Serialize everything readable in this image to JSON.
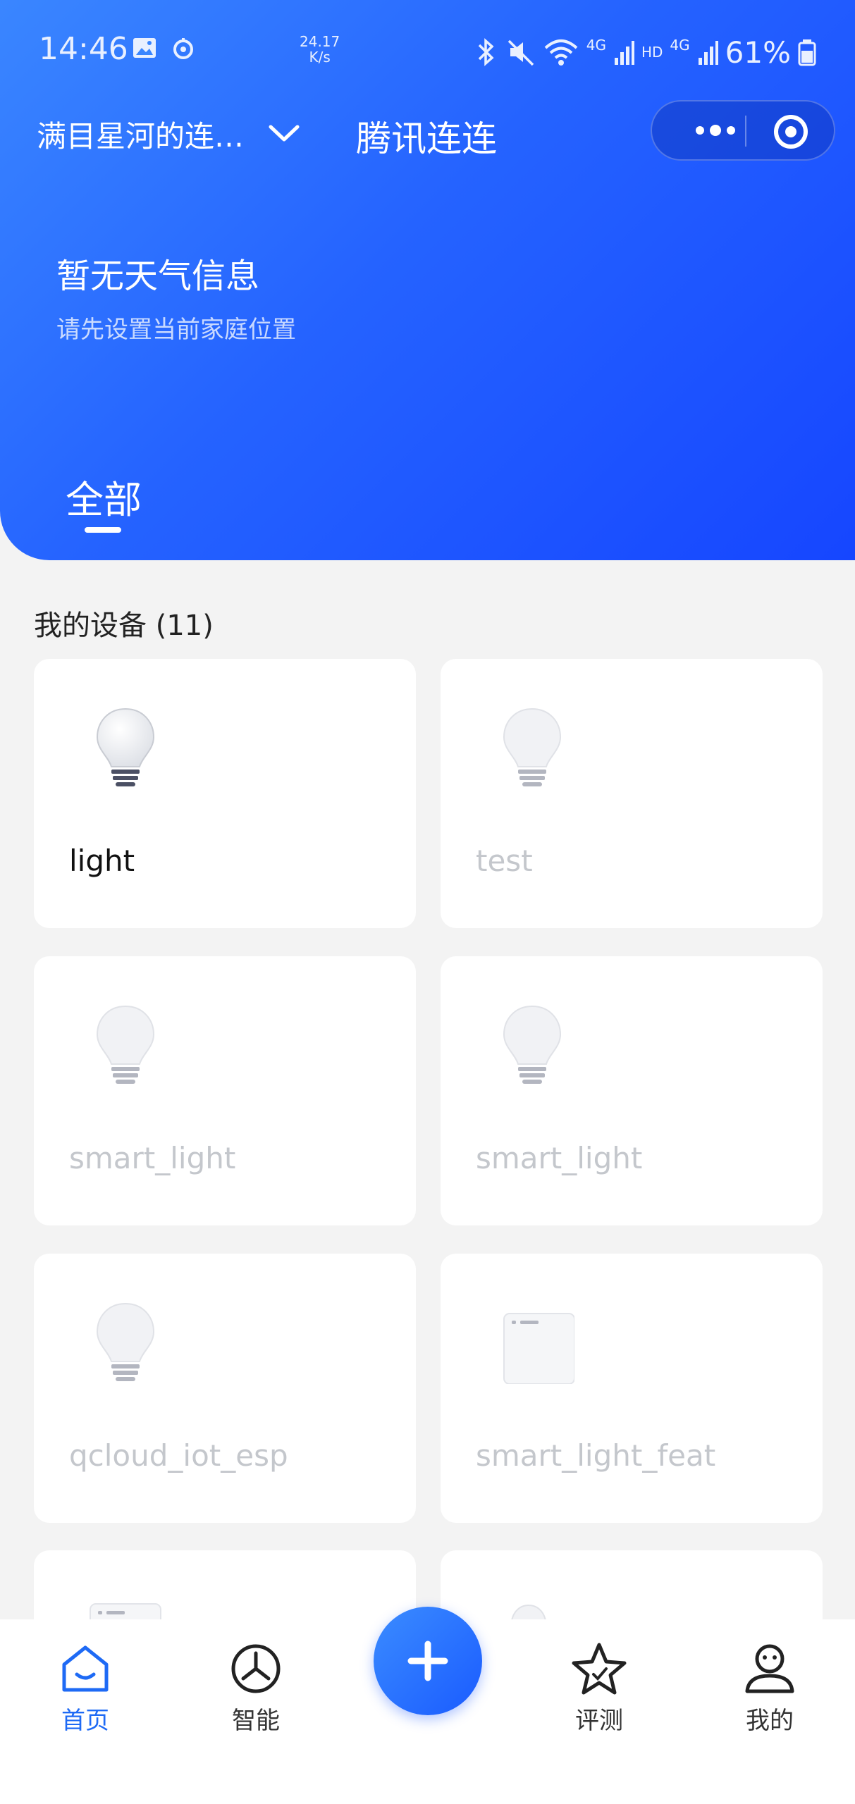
{
  "status_bar": {
    "time": "14:46",
    "net_speed_value": "24.17",
    "net_speed_unit": "K/s",
    "network_1": "4G",
    "hd": "HD",
    "network_2": "4G",
    "battery": "61%"
  },
  "titlebar": {
    "family_name": "满目星河的连…",
    "app_title": "腾讯连连"
  },
  "weather": {
    "title": "暂无天气信息",
    "subtitle": "请先设置当前家庭位置"
  },
  "tabs": [
    {
      "label": "全部"
    }
  ],
  "devices_section": {
    "title": "我的设备 (11)"
  },
  "devices": [
    {
      "name": "light",
      "icon": "bulb-icon",
      "online": true
    },
    {
      "name": "test",
      "icon": "bulb-icon",
      "online": false
    },
    {
      "name": "smart_light",
      "icon": "bulb-icon",
      "online": false
    },
    {
      "name": "smart_light",
      "icon": "bulb-icon",
      "online": false
    },
    {
      "name": "qcloud_iot_esp",
      "icon": "bulb-icon",
      "online": false
    },
    {
      "name": "smart_light_feat",
      "icon": "panel-icon",
      "online": false
    }
  ],
  "bottom_nav": [
    {
      "label": "首页",
      "icon": "home-icon",
      "active": true
    },
    {
      "label": "智能",
      "icon": "smart-icon",
      "active": false
    },
    {
      "label": "评测",
      "icon": "star-icon",
      "active": false
    },
    {
      "label": "我的",
      "icon": "user-icon",
      "active": false
    }
  ],
  "colors": {
    "accent": "#1e6af5",
    "header_start": "#3a86ff",
    "header_end": "#1646ff",
    "offline_text": "#c4c7cc"
  }
}
